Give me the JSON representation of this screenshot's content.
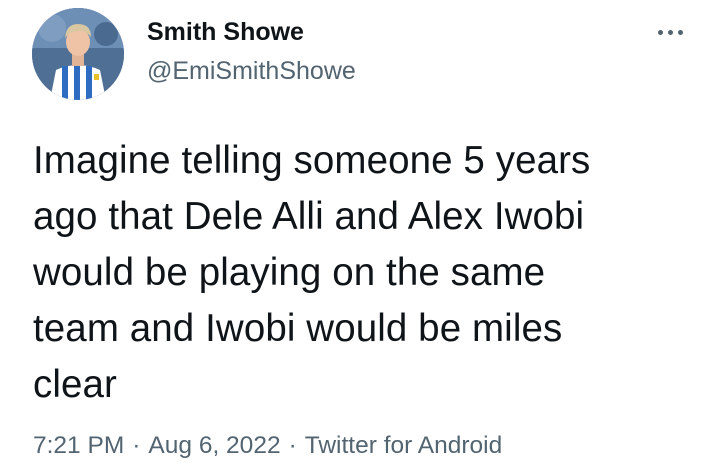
{
  "author": {
    "display_name": "Smith Showe",
    "handle": "@EmiSmithShowe",
    "avatar": "profile-photo-footballer-blue-white-striped-kit"
  },
  "menu_icon": "more-horizontal-icon",
  "tweet": {
    "text": "Imagine telling someone 5 years\nago that Dele Alli and Alex Iwobi\nwould be playing on the same\nteam and Iwobi would be miles\nclear"
  },
  "meta": {
    "time": "7:21 PM",
    "separator": "·",
    "date": "Aug 6, 2022",
    "source": "Twitter for Android"
  },
  "colors": {
    "text": "#0f1419",
    "secondary": "#536471",
    "background": "#ffffff"
  }
}
